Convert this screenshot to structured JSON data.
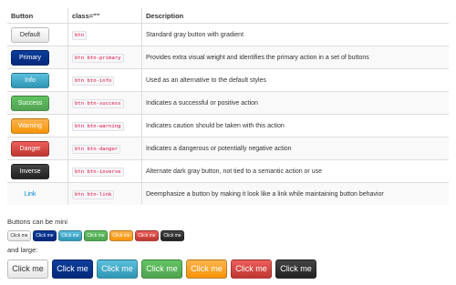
{
  "table": {
    "headers": [
      "Button",
      "class=\"\"",
      "Description"
    ],
    "rows": [
      {
        "label": "Default",
        "cls": "btn",
        "desc": "Standard gray button with gradient"
      },
      {
        "label": "Primary",
        "cls": "btn btn-primary",
        "desc": "Provides extra visual weight and identifies the primary action in a set of buttons"
      },
      {
        "label": "Info",
        "cls": "btn btn-info",
        "desc": "Used as an alternative to the default styles"
      },
      {
        "label": "Success",
        "cls": "btn btn-success",
        "desc": "Indicates a successful or positive action"
      },
      {
        "label": "Warning",
        "cls": "btn btn-warning",
        "desc": "Indicates caution should be taken with this action"
      },
      {
        "label": "Danger",
        "cls": "btn btn-danger",
        "desc": "Indicates a dangerous or potentially negative action"
      },
      {
        "label": "Inverse",
        "cls": "btn btn-inverse",
        "desc": "Alternate dark gray button, not tied to a semantic action or use"
      },
      {
        "label": "Link",
        "cls": "btn btn-link",
        "desc": "Deemphasize a button by making it look like a link while maintaining button behavior"
      }
    ]
  },
  "mini_caption": "Buttons can be mini",
  "large_caption": "and large:",
  "click_label": "Click me",
  "colors": {
    "primary": "#04287a",
    "info": "#2f96b4",
    "success": "#51a351",
    "warning": "#f89406",
    "danger": "#bd362f",
    "inverse": "#222222",
    "link": "#0088cc"
  }
}
